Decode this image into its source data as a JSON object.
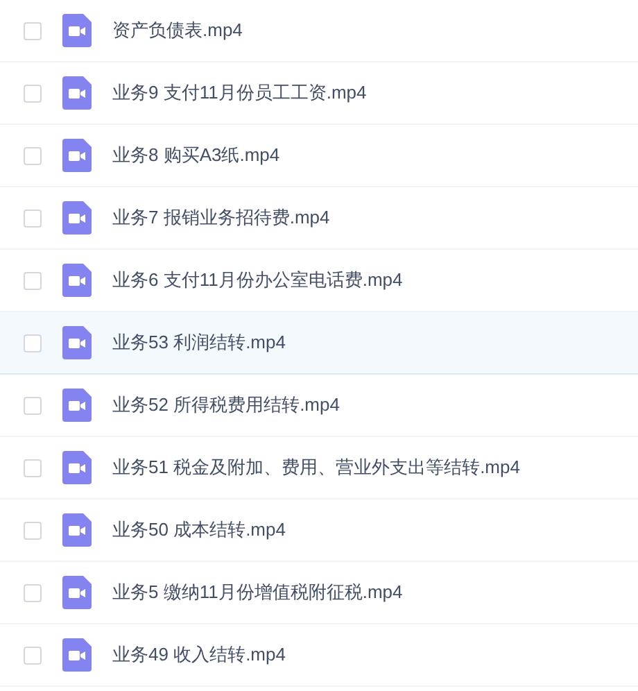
{
  "files": [
    {
      "name": "资产负债表.mp4",
      "checked": false,
      "highlighted": false
    },
    {
      "name": "业务9 支付11月份员工工资.mp4",
      "checked": false,
      "highlighted": false
    },
    {
      "name": "业务8 购买A3纸.mp4",
      "checked": false,
      "highlighted": false
    },
    {
      "name": "业务7 报销业务招待费.mp4",
      "checked": false,
      "highlighted": false
    },
    {
      "name": "业务6 支付11月份办公室电话费.mp4",
      "checked": false,
      "highlighted": false
    },
    {
      "name": "业务53 利润结转.mp4",
      "checked": false,
      "highlighted": true
    },
    {
      "name": "业务52 所得税费用结转.mp4",
      "checked": false,
      "highlighted": false
    },
    {
      "name": "业务51 税金及附加、费用、营业外支出等结转.mp4",
      "checked": false,
      "highlighted": false
    },
    {
      "name": "业务50 成本结转.mp4",
      "checked": false,
      "highlighted": false
    },
    {
      "name": "业务5 缴纳11月份增值税附征税.mp4",
      "checked": false,
      "highlighted": false
    },
    {
      "name": "业务49 收入结转.mp4",
      "checked": false,
      "highlighted": false
    }
  ]
}
